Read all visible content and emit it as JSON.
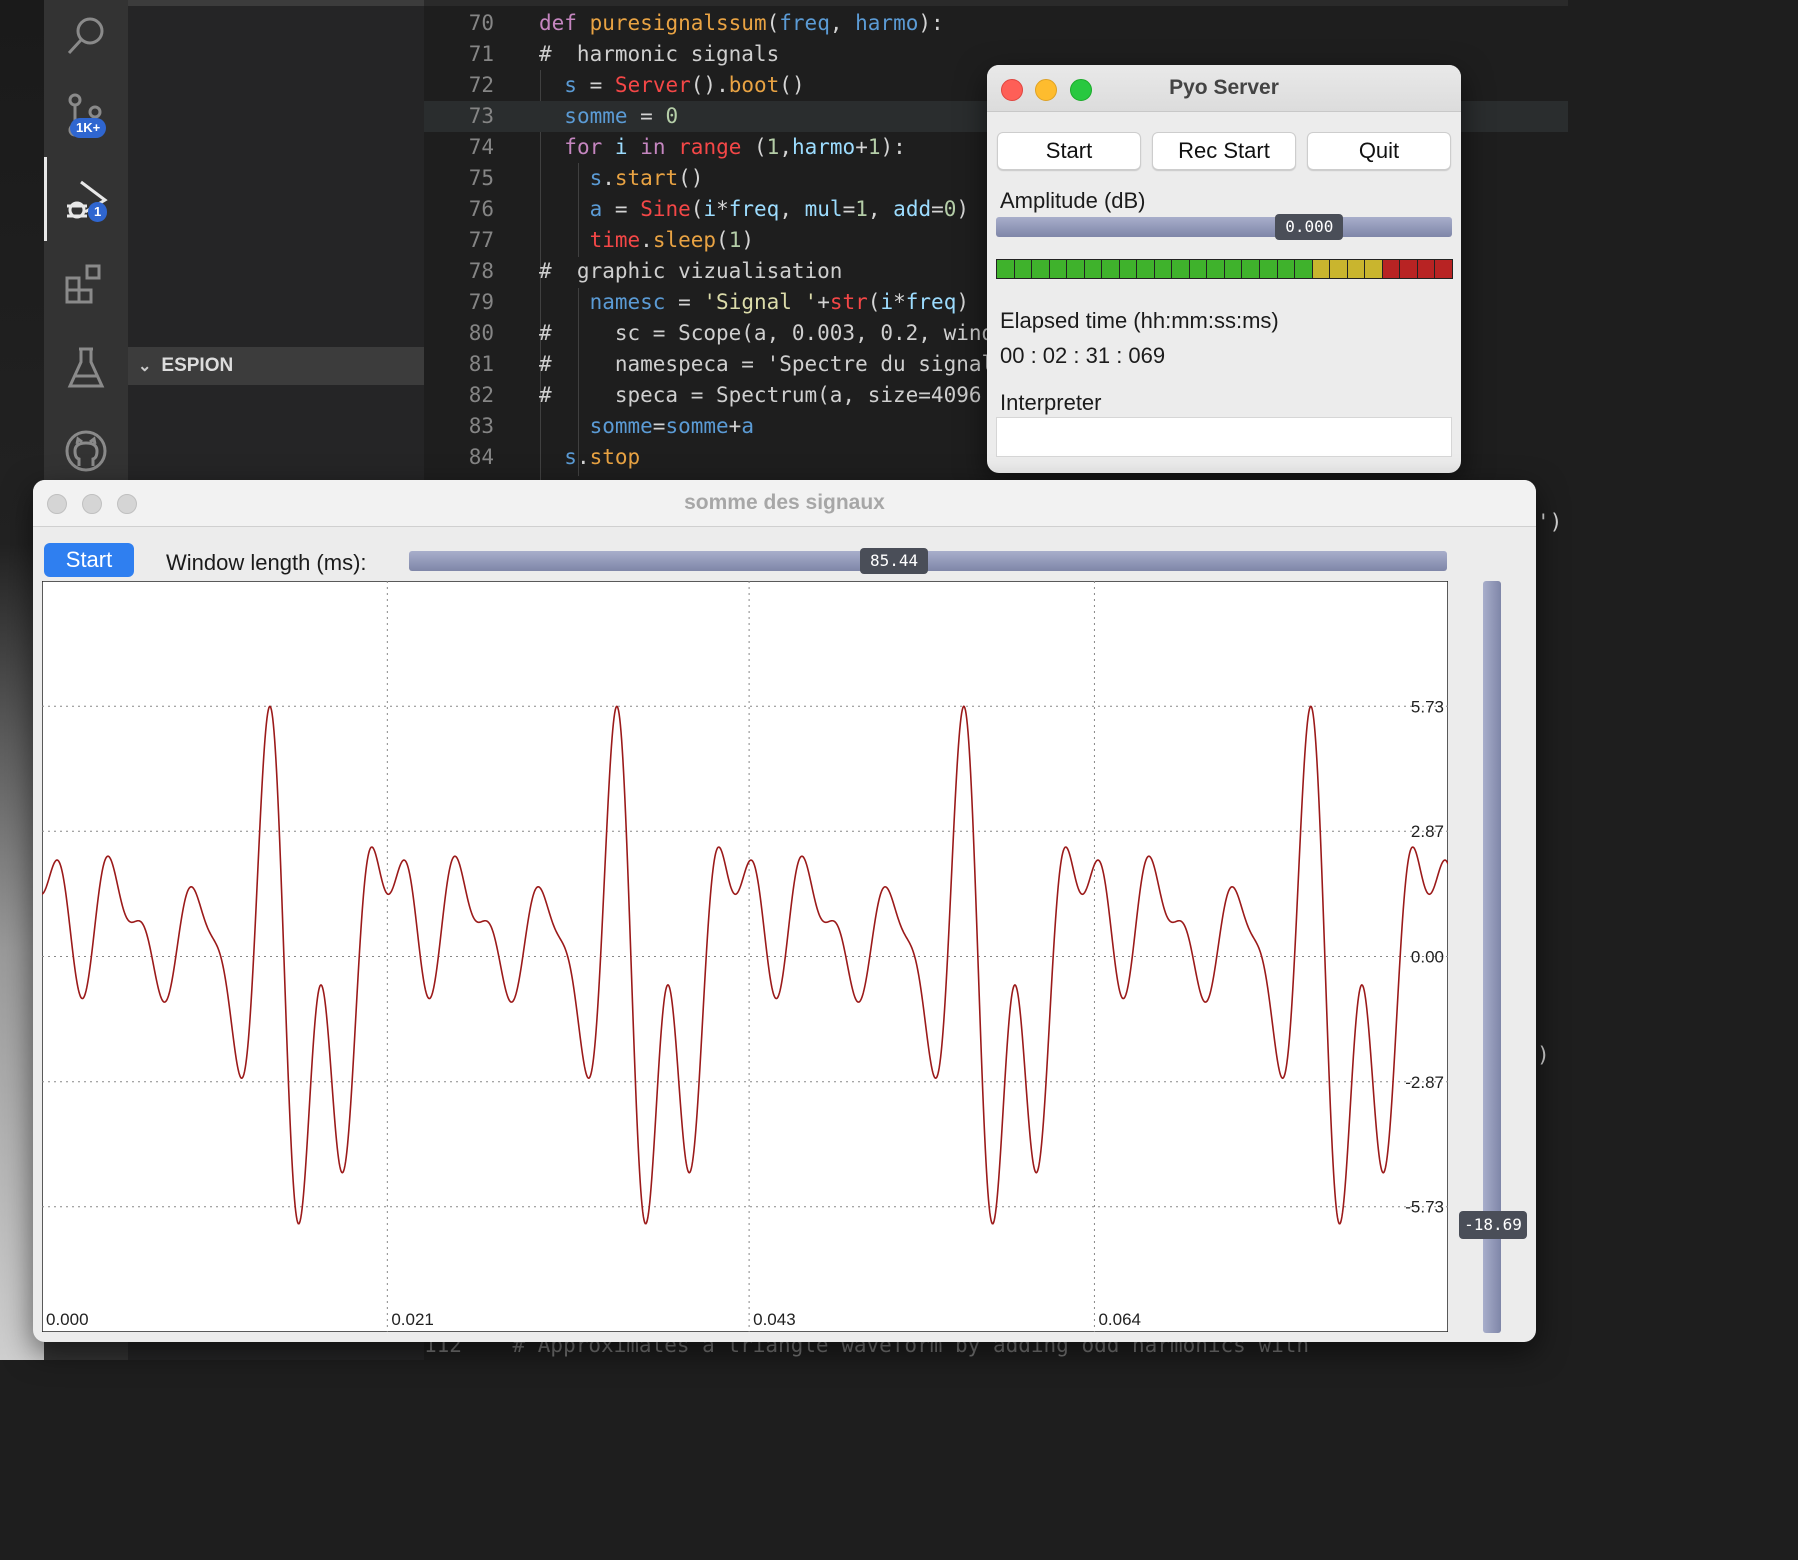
{
  "editor": {
    "lines": [
      {
        "n": "70"
      },
      {
        "n": "71"
      },
      {
        "n": "72"
      },
      {
        "n": "73"
      },
      {
        "n": "74"
      },
      {
        "n": "75"
      },
      {
        "n": "76"
      },
      {
        "n": "77"
      },
      {
        "n": "78"
      },
      {
        "n": "79"
      },
      {
        "n": "80"
      },
      {
        "n": "81"
      },
      {
        "n": "82"
      },
      {
        "n": "83"
      },
      {
        "n": "84"
      }
    ],
    "bottom_line": "112    # Approximates a triangle waveform by adding odd harmonics with",
    "edge_right_1": "')",
    "edge_right_2": ")"
  },
  "activity_bar": {
    "source_control_badge": "1K+",
    "debug_badge": "1",
    "icons": [
      "search-icon",
      "source-control-icon",
      "run-debug-icon",
      "extensions-icon",
      "testing-icon",
      "github-icon"
    ]
  },
  "side_panel": {
    "section_title": "ESPION"
  },
  "pyo_server": {
    "title": "Pyo Server",
    "buttons": {
      "start": "Start",
      "rec_start": "Rec Start",
      "quit": "Quit"
    },
    "amplitude_label": "Amplitude (dB)",
    "amplitude_value": "0.000",
    "amplitude_fraction": 0.72,
    "vu_segments": {
      "green": 18,
      "yellow": 4,
      "red": 4
    },
    "elapsed_label": "Elapsed time (hh:mm:ss:ms)",
    "elapsed_value": "00 : 02 : 31 : 069",
    "interpreter_label": "Interpreter",
    "interpreter_value": ""
  },
  "scope": {
    "title": "somme des signaux",
    "start_label": "Start",
    "window_length_label": "Window length (ms):",
    "window_length_value": "85.44",
    "window_length_fraction": 0.465,
    "gain_value": "-18.69",
    "gain_fraction": 0.13,
    "line_color": "#9b1a1a"
  },
  "chart_data": {
    "type": "line",
    "title": "",
    "xlabel": "",
    "ylabel": "",
    "x_ticks": [
      "0.000",
      "0.021",
      "0.043",
      "0.064"
    ],
    "x_tick_values": [
      0.0,
      0.021,
      0.043,
      0.064
    ],
    "y_ticks": [
      "5.73",
      "2.87",
      "0.00",
      "-2.87",
      "-5.73"
    ],
    "y_tick_values": [
      5.73,
      2.87,
      0.0,
      -2.87,
      -5.73
    ],
    "xlim": [
      0.0,
      0.0855
    ],
    "ylim": [
      -8.6,
      8.6
    ],
    "grid": true,
    "series": [
      {
        "signal": "sum of harmonic sines, period 0.0211",
        "period": 0.0211,
        "harmonics": [
          {
            "k": 1,
            "amp": 1.2,
            "phase": 0.0
          },
          {
            "k": 2,
            "amp": 1.2,
            "phase": 0.7
          },
          {
            "k": 3,
            "amp": 1.2,
            "phase": 1.9
          },
          {
            "k": 4,
            "amp": 1.2,
            "phase": 3.1
          },
          {
            "k": 5,
            "amp": 1.2,
            "phase": 0.4
          },
          {
            "k": 6,
            "amp": 1.2,
            "phase": 2.3
          },
          {
            "k": 7,
            "amp": 1.2,
            "phase": 4.2
          },
          {
            "k": 8,
            "amp": 1.2,
            "phase": 5.5
          }
        ]
      }
    ]
  }
}
